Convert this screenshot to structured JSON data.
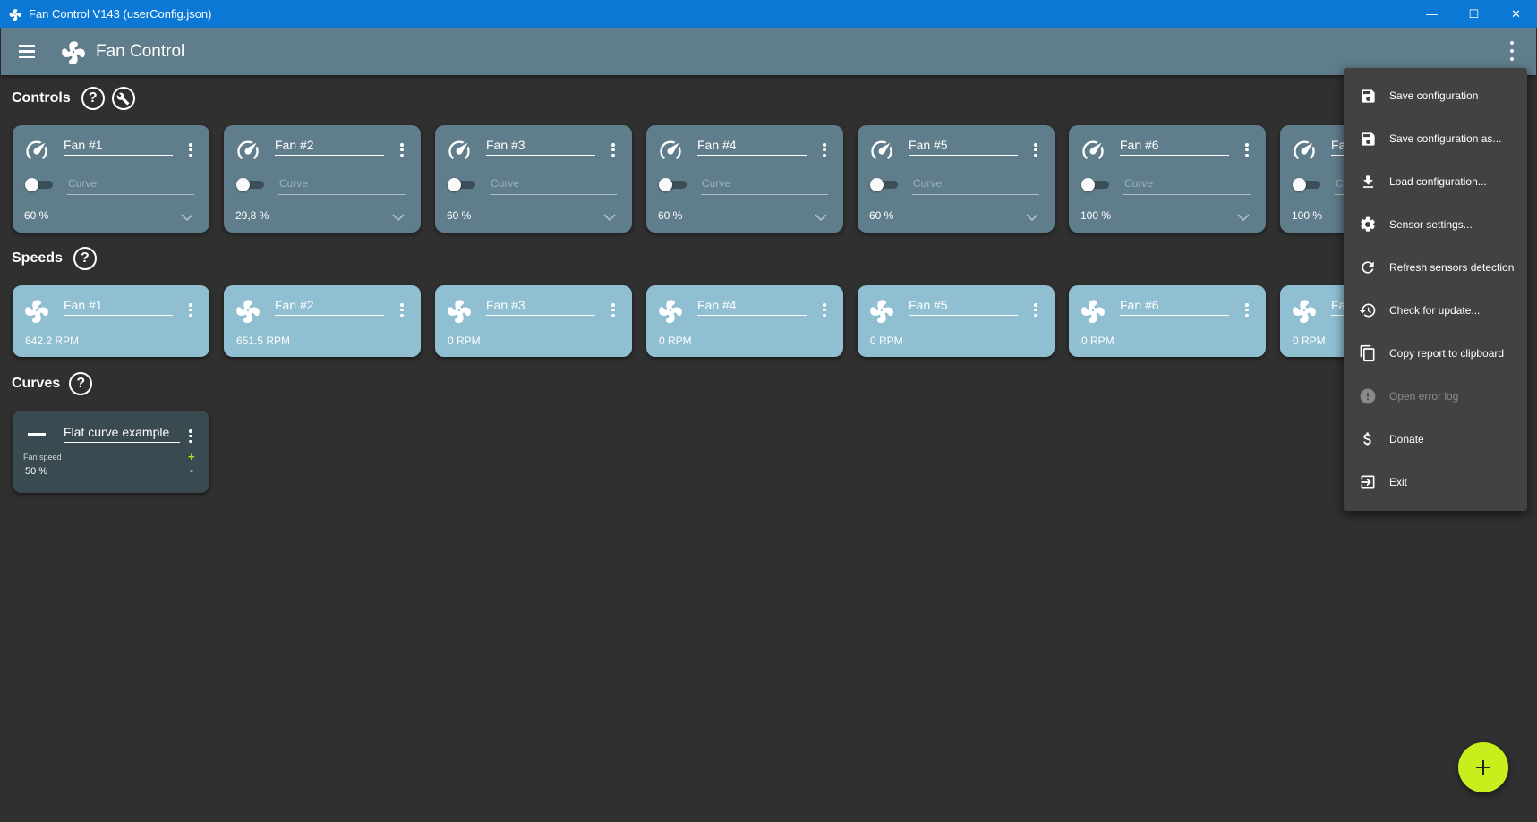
{
  "window": {
    "title": "Fan Control V143 (userConfig.json)",
    "minimize": "—",
    "maximize": "☐",
    "close": "✕"
  },
  "appbar": {
    "title": "Fan Control"
  },
  "sections": {
    "controls": "Controls",
    "speeds": "Speeds",
    "curves": "Curves",
    "help_glyph": "?"
  },
  "controls": [
    {
      "name": "Fan #1",
      "curve_placeholder": "Curve",
      "value": "60 %"
    },
    {
      "name": "Fan #2",
      "curve_placeholder": "Curve",
      "value": "29,8 %"
    },
    {
      "name": "Fan #3",
      "curve_placeholder": "Curve",
      "value": "60 %"
    },
    {
      "name": "Fan #4",
      "curve_placeholder": "Curve",
      "value": "60 %"
    },
    {
      "name": "Fan #5",
      "curve_placeholder": "Curve",
      "value": "60 %"
    },
    {
      "name": "Fan #6",
      "curve_placeholder": "Curve",
      "value": "100 %"
    },
    {
      "name": "Fa",
      "curve_placeholder": "Cu",
      "value": "100 %"
    }
  ],
  "speeds": [
    {
      "name": "Fan #1",
      "rpm": "842.2 RPM"
    },
    {
      "name": "Fan #2",
      "rpm": "651.5 RPM"
    },
    {
      "name": "Fan #3",
      "rpm": "0 RPM"
    },
    {
      "name": "Fan #4",
      "rpm": "0 RPM"
    },
    {
      "name": "Fan #5",
      "rpm": "0 RPM"
    },
    {
      "name": "Fan #6",
      "rpm": "0 RPM"
    },
    {
      "name": "Fa",
      "rpm": "0 RPM"
    }
  ],
  "curves": [
    {
      "name": "Flat curve example",
      "label": "Fan speed",
      "value": "50 %",
      "plus": "+",
      "minus": "-"
    }
  ],
  "menu": [
    {
      "label": "Save configuration",
      "icon": "save-icon",
      "enabled": true
    },
    {
      "label": "Save configuration as...",
      "icon": "save-as-icon",
      "enabled": true
    },
    {
      "label": "Load configuration...",
      "icon": "download-icon",
      "enabled": true
    },
    {
      "label": "Sensor settings...",
      "icon": "gear-icon",
      "enabled": true
    },
    {
      "label": "Refresh sensors detection",
      "icon": "refresh-icon",
      "enabled": true
    },
    {
      "label": "Check for update...",
      "icon": "history-icon",
      "enabled": true
    },
    {
      "label": "Copy report to clipboard",
      "icon": "copy-icon",
      "enabled": true
    },
    {
      "label": "Open error log",
      "icon": "alert-icon",
      "enabled": false
    },
    {
      "label": "Donate",
      "icon": "dollar-icon",
      "enabled": true
    },
    {
      "label": "Exit",
      "icon": "exit-icon",
      "enabled": true
    }
  ],
  "colors": {
    "titlebar": "#0a78d4",
    "appbar": "#607d8b",
    "background": "#303030",
    "control_card": "#607d8b",
    "speed_card": "#90bfd2",
    "curve_card": "#3a4a51",
    "menu": "#424242",
    "accent": "#c6ef1b"
  }
}
